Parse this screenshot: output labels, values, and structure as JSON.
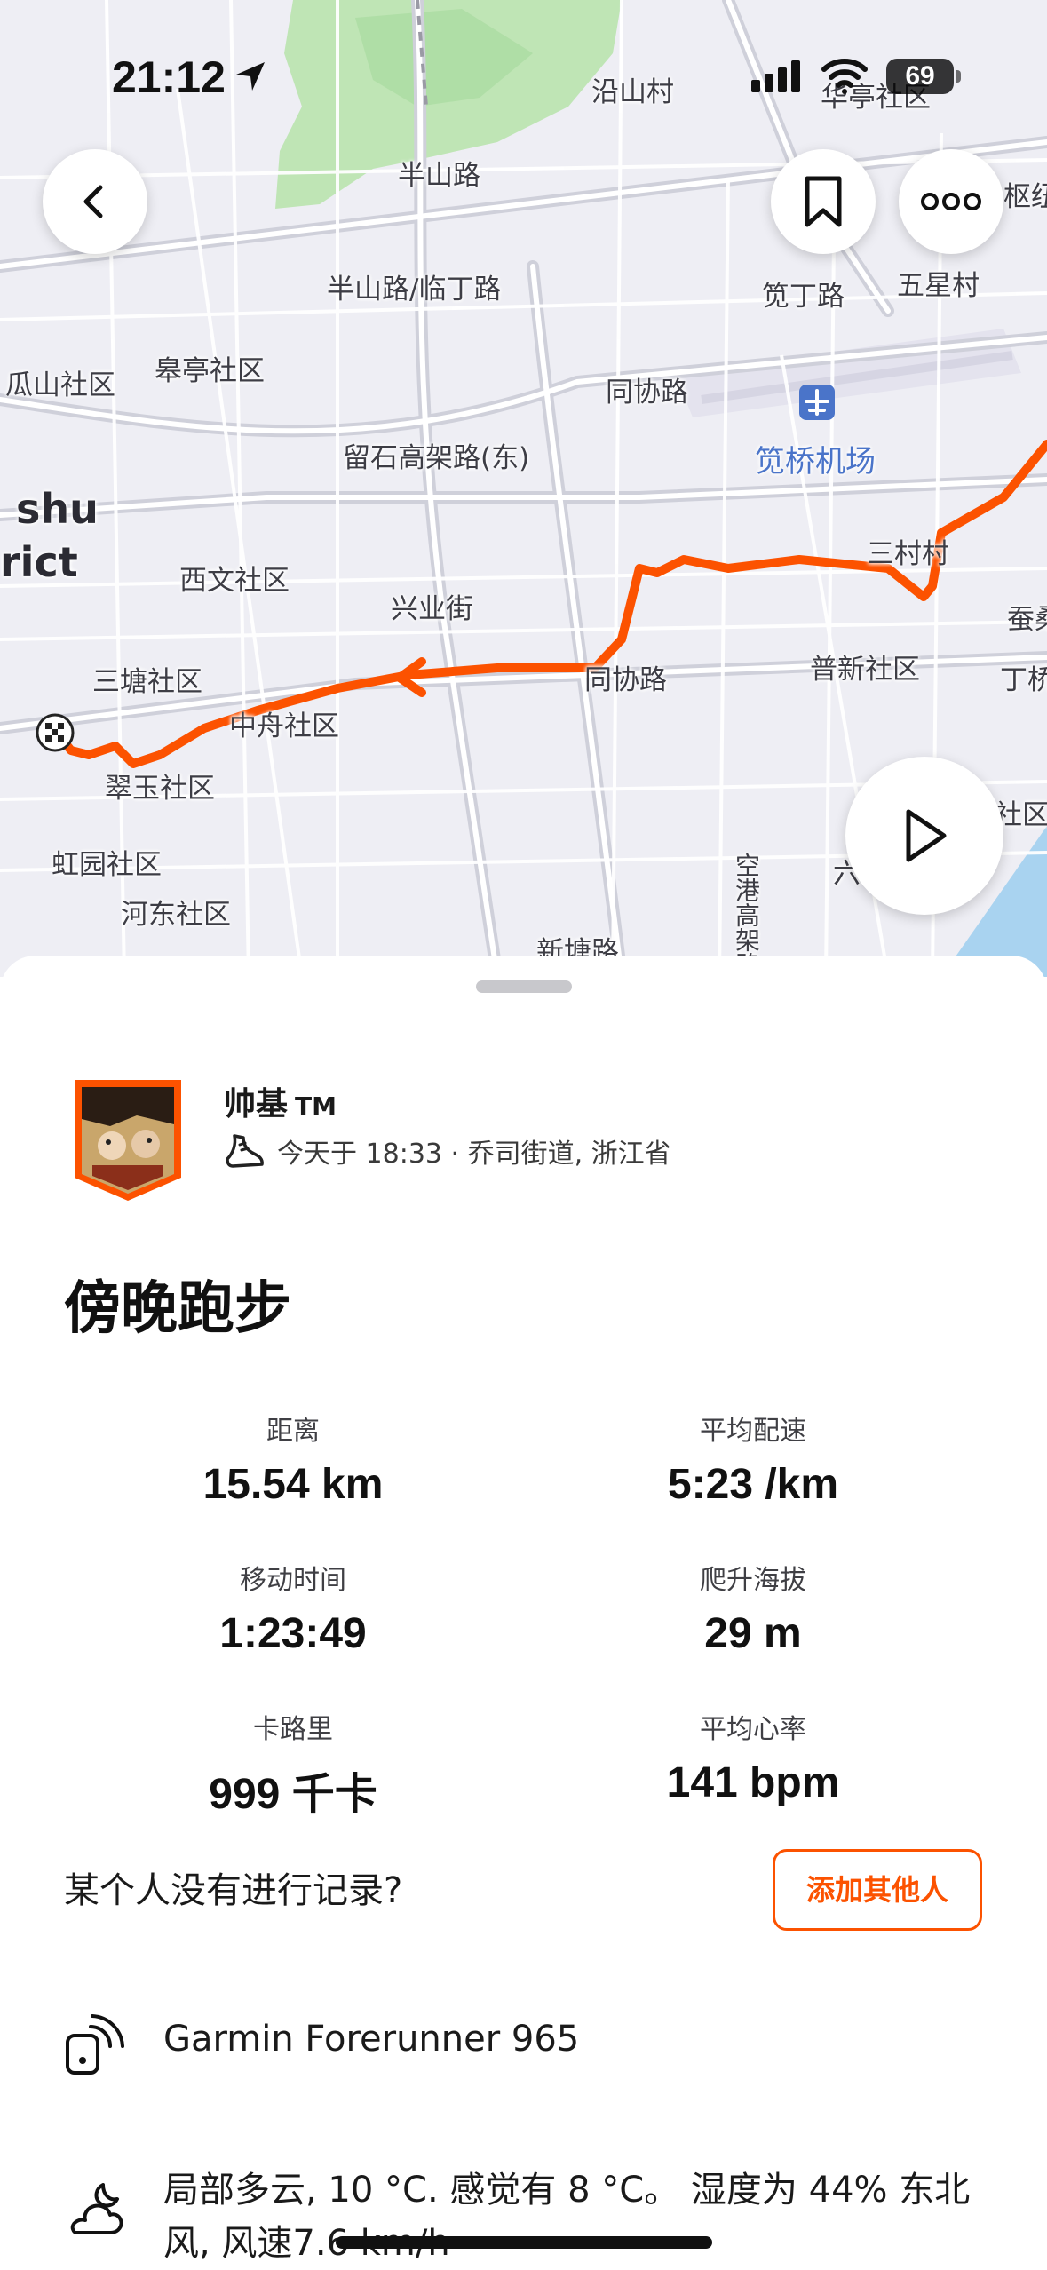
{
  "status_bar": {
    "time": "21:12",
    "battery": "69",
    "icons": [
      "location-arrow-icon",
      "signal-icon",
      "wifi-icon",
      "battery-icon"
    ]
  },
  "map": {
    "labels": [
      {
        "text": "沿山村"
      },
      {
        "text": "华亭社区"
      },
      {
        "text": "半山路"
      },
      {
        "text": "半山路/临丁路"
      },
      {
        "text": "笕丁路"
      },
      {
        "text": "五星村"
      },
      {
        "text": "枢纽"
      },
      {
        "text": "皋亭社区"
      },
      {
        "text": "瓜山社区"
      },
      {
        "text": "同协路"
      },
      {
        "text": "笕桥机场"
      },
      {
        "text": "留石高架路(东)"
      },
      {
        "text": "shu"
      },
      {
        "text": "rict"
      },
      {
        "text": "西文社区"
      },
      {
        "text": "三村村"
      },
      {
        "text": "兴业街"
      },
      {
        "text": "蚕桑"
      },
      {
        "text": "三塘社区"
      },
      {
        "text": "同协路"
      },
      {
        "text": "普新社区"
      },
      {
        "text": "丁桥"
      },
      {
        "text": "中舟社区"
      },
      {
        "text": "翠玉社区"
      },
      {
        "text": "虹园社区"
      },
      {
        "text": "河东社区"
      },
      {
        "text": "空港高架路"
      },
      {
        "text": "新塘路"
      },
      {
        "text": "社区"
      },
      {
        "text": "六"
      }
    ],
    "route_color": "#fc5200",
    "buttons": {
      "back_icon": "chevron-left-icon",
      "bookmark_icon": "bookmark-icon",
      "more_icon": "more-icon",
      "play_icon": "play-icon"
    }
  },
  "activity": {
    "athlete_name": "帅基",
    "tm_mark": "TM",
    "sport_icon": "shoe-icon",
    "meta": "今天于 18:33 · 乔司街道, 浙江省",
    "title": "傍晚跑步",
    "stats": [
      {
        "label": "距离",
        "value": "15.54 km"
      },
      {
        "label": "平均配速",
        "value": "5:23 /km"
      },
      {
        "label": "移动时间",
        "value": "1:23:49"
      },
      {
        "label": "爬升海拔",
        "value": "29 m"
      },
      {
        "label": "卡路里",
        "value": "999 千卡"
      },
      {
        "label": "平均心率",
        "value": "141 bpm"
      }
    ],
    "missing_prompt": "某个人没有进行记录?",
    "add_others_label": "添加其他人",
    "device": "Garmin Forerunner 965",
    "device_icon": "device-icon",
    "weather": "局部多云, 10 °C. 感觉有 8 °C。 湿度为 44% 东北风, 风速7.6 km/h",
    "weather_icon": "cloud-moon-icon"
  },
  "colors": {
    "accent": "#fc5200",
    "map_bg": "#eeeef4",
    "park_green": "#bfe5b5",
    "water_blue": "#a9d3f0"
  }
}
